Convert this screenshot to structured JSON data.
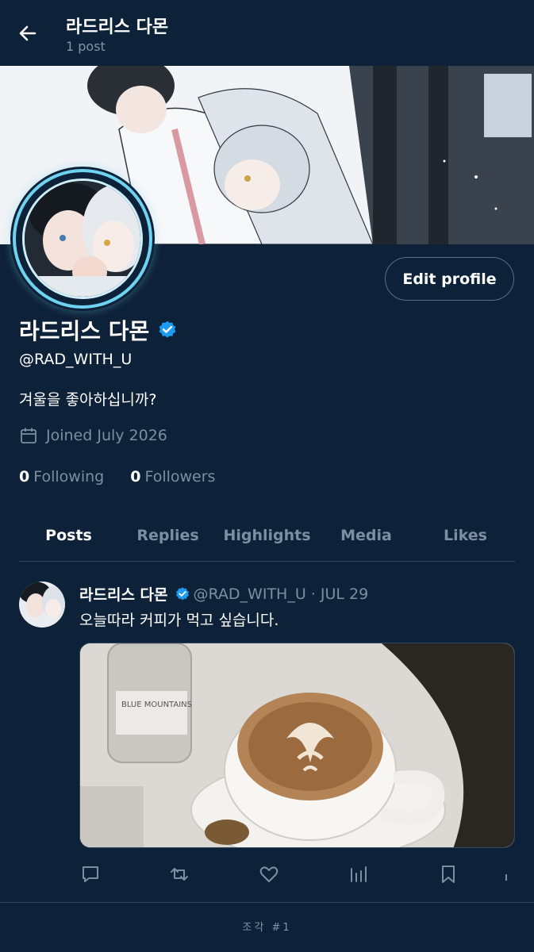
{
  "header": {
    "title": "라드리스 다몬",
    "subtitle": "1 post",
    "back_icon": "arrow-left-icon"
  },
  "profile": {
    "display_name": "라드리스 다몬",
    "handle": "@RAD_WITH_U",
    "bio": "겨울을 좋아하십니까?",
    "joined": "Joined July 2026",
    "following_count": "0",
    "following_label": "Following",
    "followers_count": "0",
    "followers_label": "Followers",
    "edit_label": "Edit profile",
    "verified_color": "#1d9bf0",
    "ring_color": "#6fd3f0"
  },
  "tabs": [
    {
      "label": "Posts",
      "active": true
    },
    {
      "label": "Replies",
      "active": false
    },
    {
      "label": "Highlights",
      "active": false
    },
    {
      "label": "Media",
      "active": false
    },
    {
      "label": "Likes",
      "active": false
    }
  ],
  "post": {
    "name": "라드리스 다몬",
    "handle_date": "@RAD_WITH_U · JUL 29",
    "text": "오늘따라 커피가 먹고 싶습니다.",
    "image_text": "BLUE MOUNTAINS",
    "actions": [
      "reply-icon",
      "repost-icon",
      "like-icon",
      "views-icon",
      "bookmark-icon"
    ]
  },
  "footer": {
    "text": "조각 #1"
  },
  "colors": {
    "background": "#0d2138",
    "muted": "#7c8fa1",
    "border": "#33485c"
  }
}
